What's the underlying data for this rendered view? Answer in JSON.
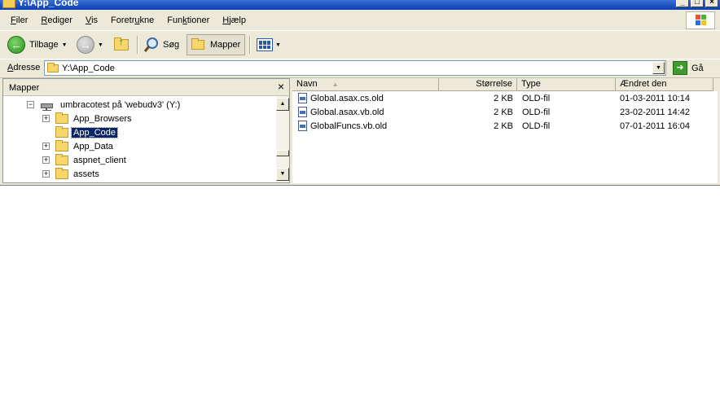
{
  "window": {
    "title": "Y:\\App_Code"
  },
  "menu": [
    {
      "pre": "",
      "key": "F",
      "post": "iler"
    },
    {
      "pre": "",
      "key": "R",
      "post": "ediger"
    },
    {
      "pre": "",
      "key": "V",
      "post": "is"
    },
    {
      "pre": "Foretr",
      "key": "u",
      "post": "kne"
    },
    {
      "pre": "Fun",
      "key": "k",
      "post": "tioner"
    },
    {
      "pre": "",
      "key": "H",
      "post": "jælp"
    }
  ],
  "toolbar": {
    "back_label": "Tilbage",
    "search_label": "Søg",
    "folders_label": "Mapper"
  },
  "address": {
    "label": "Adresse",
    "label_key": "A",
    "label_rest": "dresse",
    "value": "Y:\\App_Code",
    "go_label": "Gå"
  },
  "folder_pane": {
    "title": "Mapper",
    "items": [
      {
        "label": "umbracotest på 'webudv3' (Y:)",
        "expander": "−",
        "type": "drive"
      },
      {
        "label": "App_Browsers",
        "expander": "+",
        "type": "folder"
      },
      {
        "label": "App_Code",
        "expander": "",
        "type": "folder",
        "selected": true
      },
      {
        "label": "App_Data",
        "expander": "+",
        "type": "folder"
      },
      {
        "label": "aspnet_client",
        "expander": "+",
        "type": "folder"
      },
      {
        "label": "assets",
        "expander": "+",
        "type": "folder"
      }
    ]
  },
  "file_list": {
    "columns": [
      "Navn",
      "Størrelse",
      "Type",
      "Ændret den"
    ],
    "rows": [
      {
        "name": "Global.asax.cs.old",
        "size": "2 KB",
        "type": "OLD-fil",
        "modified": "01-03-2011 10:14"
      },
      {
        "name": "Global.asax.vb.old",
        "size": "2 KB",
        "type": "OLD-fil",
        "modified": "23-02-2011 14:42"
      },
      {
        "name": "GlobalFuncs.vb.old",
        "size": "2 KB",
        "type": "OLD-fil",
        "modified": "07-01-2011 16:04"
      }
    ]
  },
  "icons": {
    "back": "back-arrow-icon",
    "forward": "forward-arrow-icon",
    "up": "up-folder-icon",
    "search": "search-icon",
    "folders": "folders-icon",
    "views": "views-icon",
    "go": "go-arrow-icon"
  },
  "colors": {
    "titlebar": "#0a3fb0",
    "selection": "#0a246a",
    "chrome": "#ece9d8"
  }
}
